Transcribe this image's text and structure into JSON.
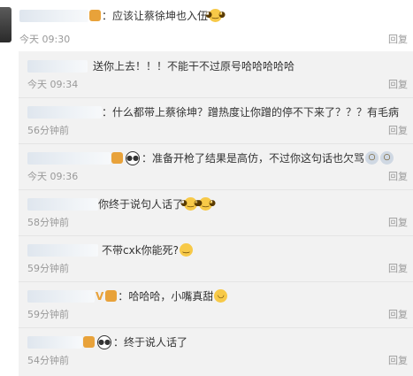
{
  "main_comment": {
    "suffix_sep": "：",
    "text": "应该让蔡徐坤也入伍",
    "time": "今天 09:30",
    "reply_label": "回复"
  },
  "replies": [
    {
      "sep": "",
      "text": "送你上去！！！不能干不过原号哈哈哈哈哈",
      "time": "今天 09:34",
      "reply_label": "回复"
    },
    {
      "sep": "：",
      "text": "什么都带上蔡徐坤？蹭热度让你蹭的停不下来了？？？有毛病",
      "time": "56分钟前",
      "reply_label": "回复"
    },
    {
      "sep": "：",
      "text": "准备开枪了结果是高仿，不过你这句话也欠骂",
      "time": "今天 09:36",
      "reply_label": "回复"
    },
    {
      "sep": "",
      "text": "你终于说句人话了",
      "time": "58分钟前",
      "reply_label": "回复"
    },
    {
      "sep": "",
      "text": "不带cxk你能死?",
      "time": "59分钟前",
      "reply_label": "回复"
    },
    {
      "sep": "：",
      "text": "哈哈哈，小嘴真甜",
      "time": "59分钟前",
      "reply_label": "回复"
    },
    {
      "sep": "：",
      "text": "终于说人话了",
      "time": "54分钟前",
      "reply_label": "回复"
    }
  ],
  "colors": {
    "text": "#333333",
    "meta": "#999999",
    "panel": "#f2f2f2"
  },
  "icons": [
    "avatar",
    "vip-badge-icon",
    "laugh-cat-emoji-icon",
    "panda-icon",
    "grin-emoji-icon",
    "shocked-emoji-icon",
    "v-badge-icon",
    "cry-laugh-emoji-icon"
  ]
}
